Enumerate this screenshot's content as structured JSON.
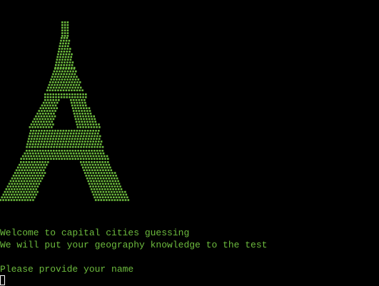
{
  "colors": {
    "background": "#000000",
    "text": "#6dbb3e",
    "art": "#6dbb3e",
    "cursor": "#ffffff"
  },
  "ascii_art": {
    "subject": "eiffel-tower"
  },
  "terminal": {
    "welcome_line": "Welcome to capital cities guessing",
    "intro_line": "We will put your geography knowledge to the test",
    "prompt_line": "Please provide your name",
    "input_value": ""
  }
}
